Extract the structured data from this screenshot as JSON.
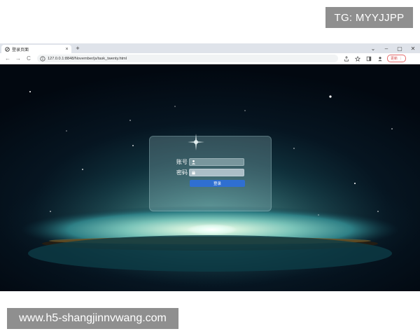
{
  "overlay_badge": "TG: MYYJJPP",
  "watermark": "www.h5-shangjinnvwang.com",
  "browser": {
    "tab": {
      "favicon": "browser-favicon-icon",
      "title": "登录页面",
      "close": "×"
    },
    "new_tab": "+",
    "window_controls": {
      "minimize": "–",
      "maximize": "▢",
      "close": "✕",
      "tab_search": "⌄"
    },
    "nav": {
      "back": "←",
      "forward": "→",
      "reload": "C"
    },
    "address_bar": {
      "icon": "info-icon",
      "url": "127.0.0.1:8848/November/js/task_twenty.html"
    },
    "toolbar_icons": [
      "share-icon",
      "star-icon",
      "sidebar-icon",
      "profile-icon"
    ],
    "update_button": {
      "label": "更新",
      "menu": "⋮"
    }
  },
  "login": {
    "account_label": "账号",
    "password_label": "密码",
    "login_button": "登录",
    "account_icon": "user-icon",
    "password_icon": "lock-icon"
  },
  "colors": {
    "button": "#2f6fd1",
    "update_border": "#e46a6a",
    "badge_bg": "#8f8f8f"
  }
}
